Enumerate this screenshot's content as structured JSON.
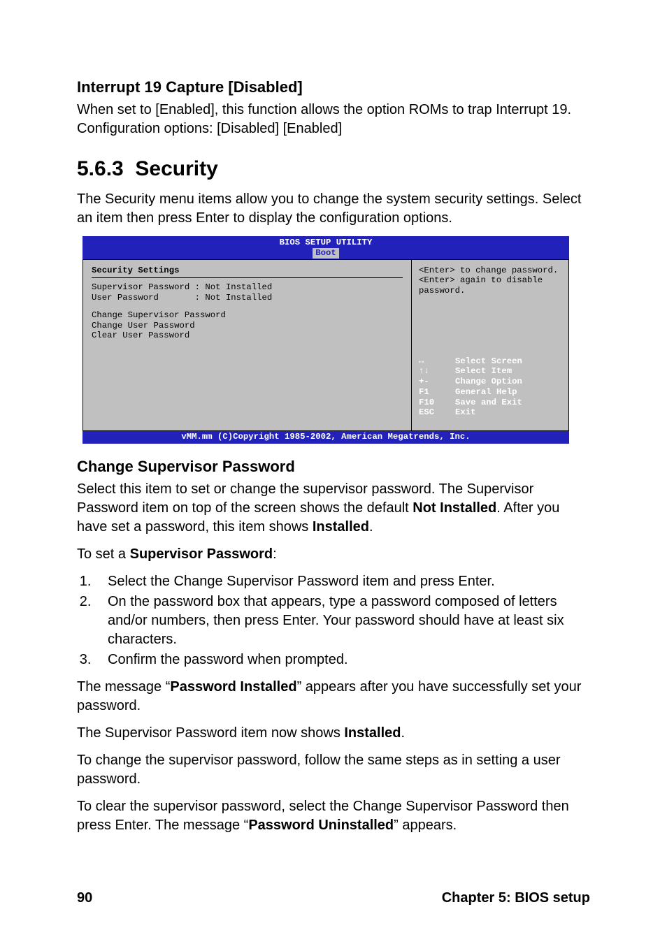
{
  "heading_interrupt": "Interrupt 19 Capture [Disabled]",
  "interrupt_text": "When set to [Enabled], this function allows the option ROMs to trap Interrupt 19. Configuration options: [Disabled] [Enabled]",
  "section_number": "5.6.3",
  "section_title": "Security",
  "security_intro": "The Security menu items allow you to change the system security settings. Select an item then press Enter to display the configuration options.",
  "bios": {
    "title": "BIOS SETUP UTILITY",
    "tab": "Boot",
    "left_heading": "Security Settings",
    "supervisor_line": "Supervisor Password : Not Installed",
    "user_line": "User Password       : Not Installed",
    "menu_items": [
      "Change Supervisor Password",
      "Change User Password",
      "Clear User Password"
    ],
    "help1": "<Enter> to change password.",
    "help2": "<Enter> again to disable password.",
    "nav": [
      {
        "sym": "↔",
        "label": "Select Screen"
      },
      {
        "sym": "↑↓",
        "label": "Select Item"
      },
      {
        "sym": "+-",
        "label": "Change Option"
      },
      {
        "sym": "F1",
        "label": "General Help"
      },
      {
        "sym": "F10",
        "label": "Save and Exit"
      },
      {
        "sym": "ESC",
        "label": "Exit"
      }
    ],
    "footer": "vMM.mm (C)Copyright 1985-2002, American Megatrends, Inc."
  },
  "csp_heading": "Change Supervisor Password",
  "csp_p1_a": "Select this item to set or change the supervisor password. The Supervisor Password item on top of the screen shows the default ",
  "csp_p1_b": "Not Installed",
  "csp_p1_c": ". After you have set a password, this item shows ",
  "csp_p1_d": "Installed",
  "csp_p1_e": ".",
  "csp_p2_a": "To set a ",
  "csp_p2_b": "Supervisor Password",
  "csp_p2_c": ":",
  "steps": [
    "Select the Change Supervisor Password item and press Enter.",
    "On the password box that appears, type a password composed of letters and/or numbers, then press Enter. Your password should have at least six characters.",
    "Confirm the password when prompted."
  ],
  "msg1_a": "The message “",
  "msg1_b": "Password Installed",
  "msg1_c": "” appears after you have successfully set your password.",
  "msg2_a": "The Supervisor Password item now shows ",
  "msg2_b": "Installed",
  "msg2_c": ".",
  "msg3": "To change the supervisor password, follow the same steps as in setting a user password.",
  "msg4_a": "To clear the supervisor password, select the Change Supervisor Password then press Enter. The message “",
  "msg4_b": "Password Uninstalled",
  "msg4_c": "” appears.",
  "page_number": "90",
  "chapter": "Chapter 5: BIOS setup"
}
